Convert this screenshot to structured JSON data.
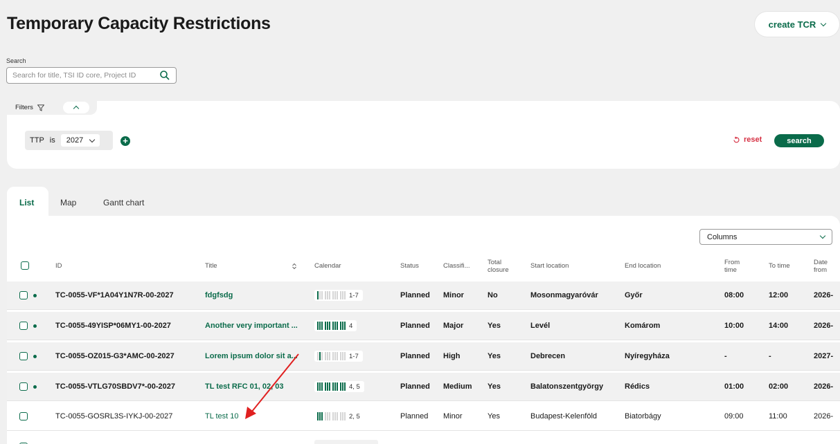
{
  "page_title": "Temporary Capacity Restrictions",
  "create_button": {
    "label": "create TCR"
  },
  "search": {
    "label": "Search",
    "placeholder": "Search for title, TSI ID core, Project ID"
  },
  "filters": {
    "label": "Filters",
    "chip": {
      "field": "TTP",
      "operator": "is",
      "value": "2027"
    },
    "reset_label": "reset",
    "search_label": "search"
  },
  "tabs": [
    {
      "label": "List"
    },
    {
      "label": "Map"
    },
    {
      "label": "Gantt chart"
    }
  ],
  "columns_select": {
    "label": "Columns"
  },
  "columns": [
    "ID",
    "Title",
    "Calendar",
    "Status",
    "Classifi...",
    "Total closure",
    "Start location",
    "End location",
    "From time",
    "To time",
    "Date from"
  ],
  "rows": [
    {
      "id": "TC-0055-VF*1A04Y1N7R-00-2027",
      "title": "fdgfsdg",
      "calendar_label": "1-7",
      "status": "Planned",
      "classification": "Minor",
      "total_closure": "No",
      "start": "Mosonmagyaróvár",
      "end": "Győr",
      "from": "08:00",
      "to": "12:00",
      "date_from": "2026-"
    },
    {
      "id": "TC-0055-49YISP*06MY1-00-2027",
      "title": "Another very important ...",
      "calendar_label": "4",
      "status": "Planned",
      "classification": "Major",
      "total_closure": "Yes",
      "start": "Levél",
      "end": "Komárom",
      "from": "10:00",
      "to": "14:00",
      "date_from": "2026-"
    },
    {
      "id": "TC-0055-OZ015-G3*AMC-00-2027",
      "title": "Lorem ipsum dolor sit a...",
      "calendar_label": "1-7",
      "status": "Planned",
      "classification": "High",
      "total_closure": "Yes",
      "start": "Debrecen",
      "end": "Nyíregyháza",
      "from": "-",
      "to": "-",
      "date_from": "2027-"
    },
    {
      "id": "TC-0055-VTLG70SBDV7*-00-2027",
      "title": "TL test RFC 01, 02, 03",
      "calendar_label": "4, 5",
      "status": "Planned",
      "classification": "Medium",
      "total_closure": "Yes",
      "start": "Balatonszentgyörgy",
      "end": "Rédics",
      "from": "01:00",
      "to": "02:00",
      "date_from": "2026-"
    },
    {
      "id": "TC-0055-GOSRL3S-IYKJ-00-2027",
      "title": "TL test 10",
      "calendar_label": "2, 5",
      "status": "Planned",
      "classification": "Minor",
      "total_closure": "Yes",
      "start": "Budapest-Kelenföld",
      "end": "Biatorbágy",
      "from": "09:00",
      "to": "11:00",
      "date_from": "2026-"
    }
  ],
  "colors": {
    "accent": "#0a6b4a",
    "reset": "#d63245",
    "arrow": "#e02020"
  }
}
